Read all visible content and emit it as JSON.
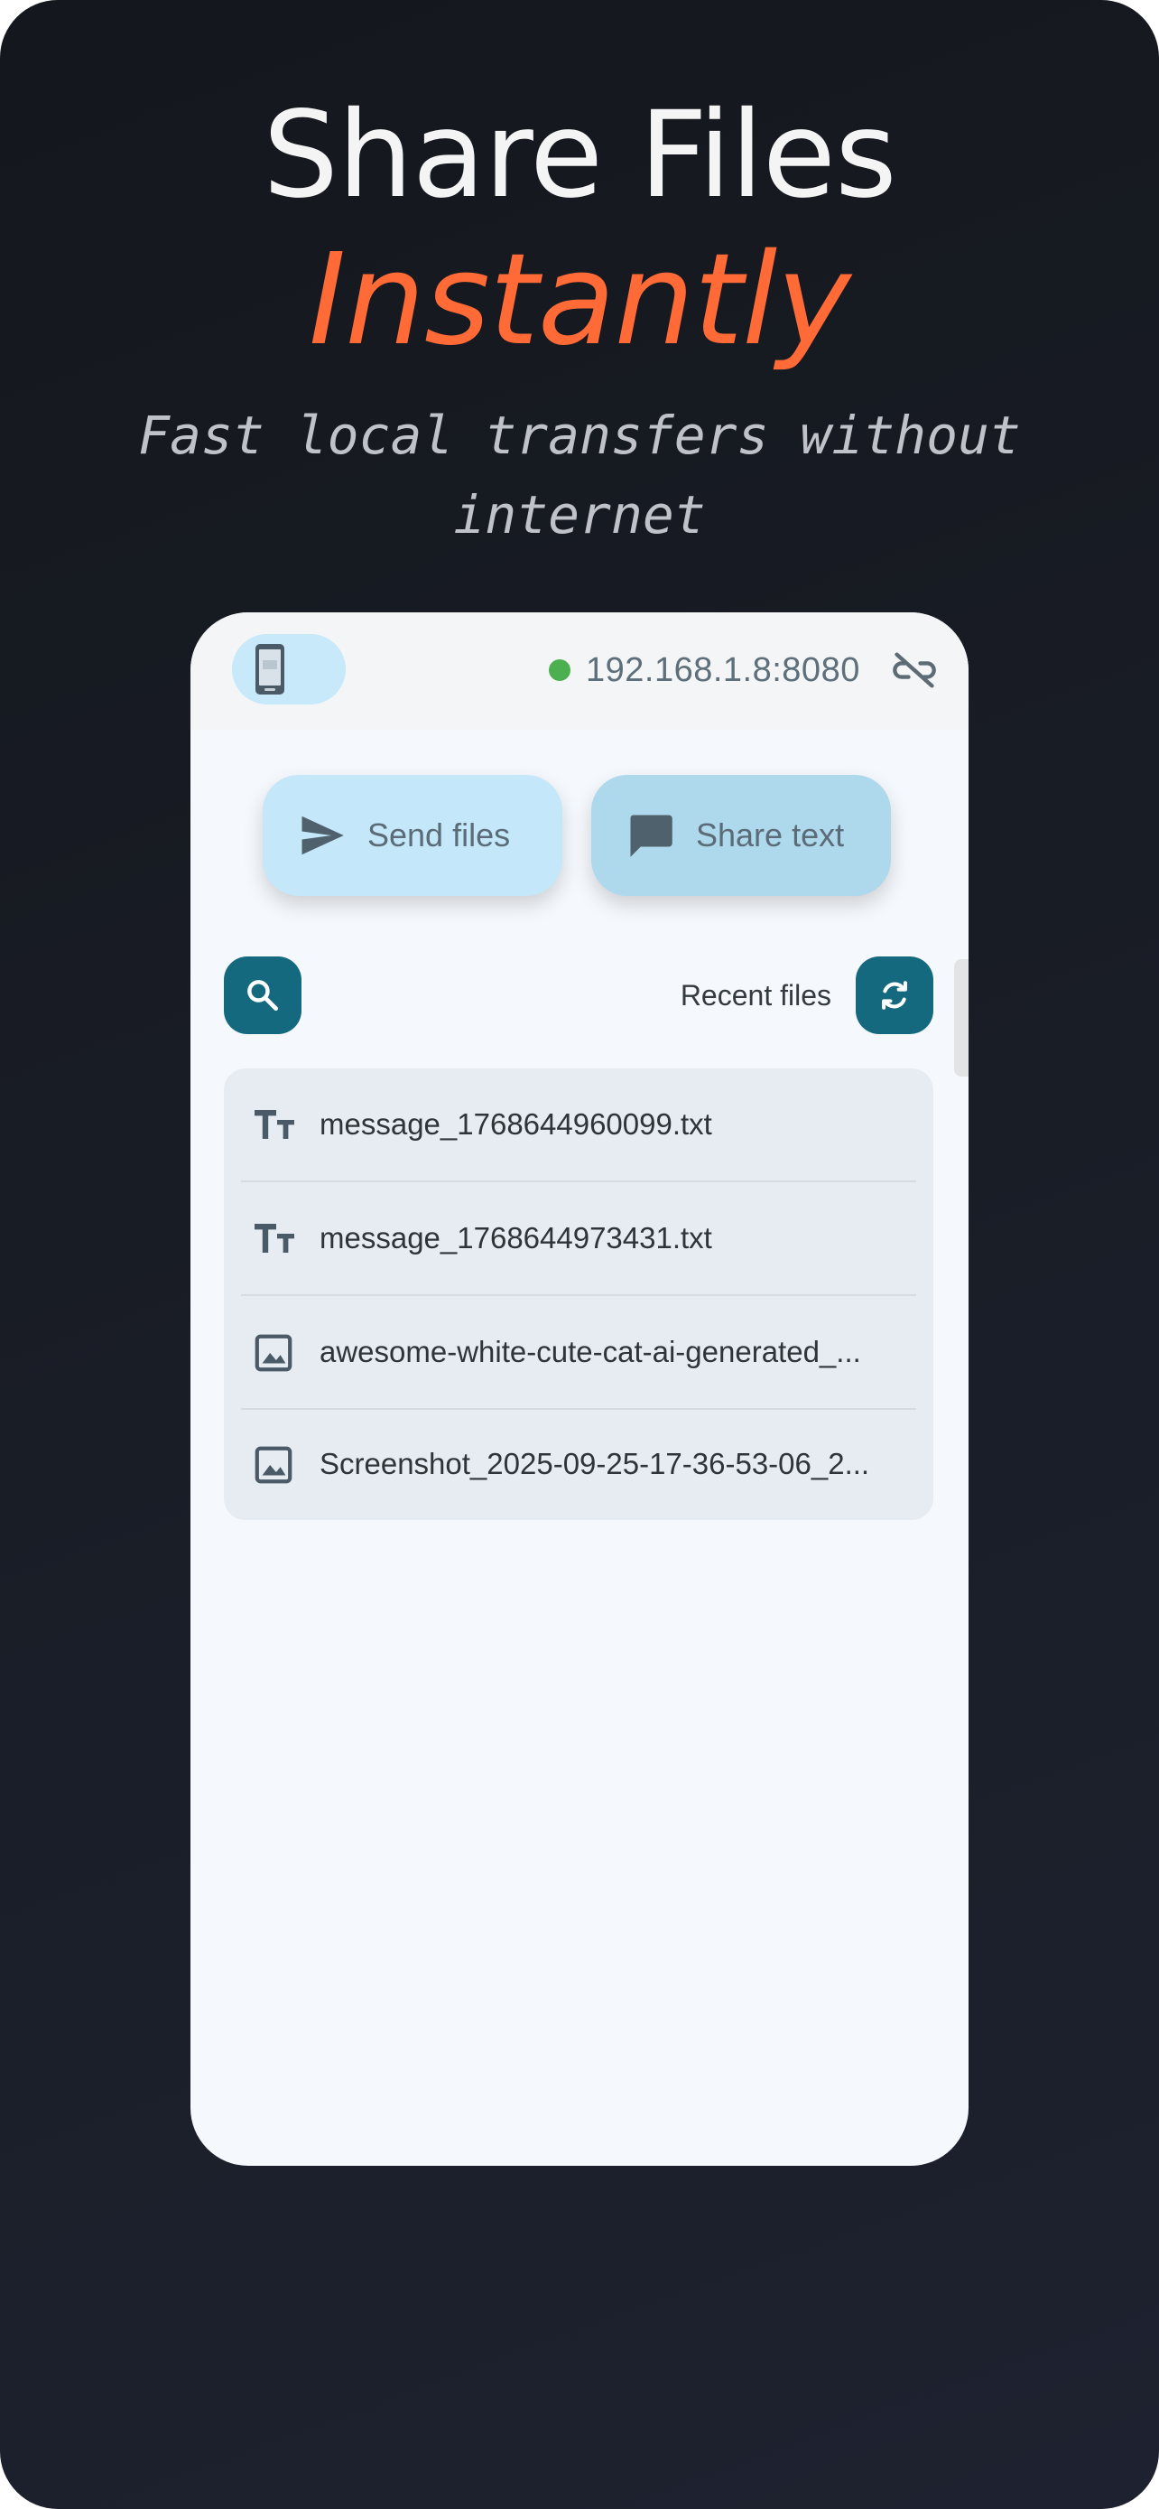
{
  "hero": {
    "title": "Share Files",
    "accent": "Instantly",
    "subtitle": "Fast local transfers without internet"
  },
  "status": {
    "address": "192.168.1.8:8080",
    "connection_color": "#4caf50"
  },
  "actions": {
    "send_label": "Send files",
    "share_label": "Share text"
  },
  "files_panel": {
    "title": "Recent files",
    "items": [
      {
        "name": "message_1768644960099.txt",
        "icon": "text-icon"
      },
      {
        "name": "message_1768644973431.txt",
        "icon": "text-icon"
      },
      {
        "name": "awesome-white-cute-cat-ai-generated_...",
        "icon": "image-icon"
      },
      {
        "name": "Screenshot_2025-09-25-17-36-53-06_2...",
        "icon": "image-icon"
      }
    ]
  },
  "colors": {
    "accent": "#ff6a36",
    "primary": "#15697f",
    "background": "#14171d"
  },
  "icons": [
    "phone-icon",
    "link-off-icon",
    "send-icon",
    "chat-icon",
    "search-icon",
    "refresh-icon",
    "text-icon",
    "image-icon"
  ]
}
